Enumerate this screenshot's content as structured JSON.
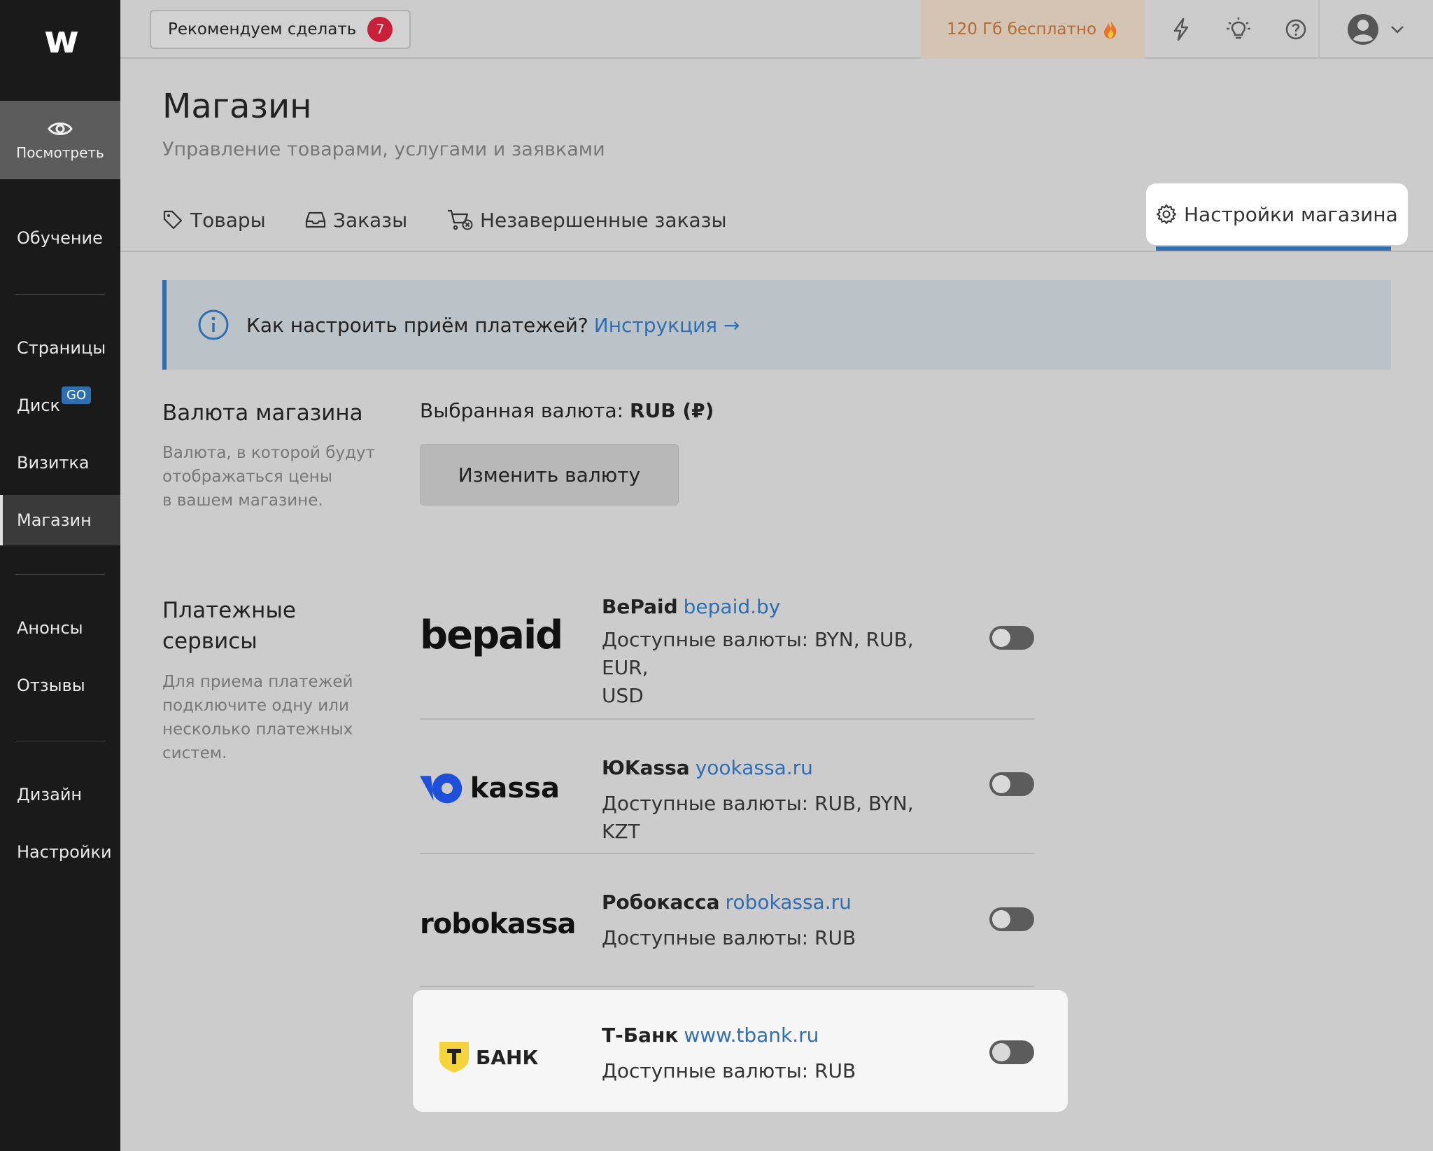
{
  "sidebar": {
    "logo": "w",
    "preview_label": "Посмотреть",
    "items": [
      {
        "label": "Обучение"
      },
      {
        "label": "Страницы"
      },
      {
        "label": "Диск"
      },
      {
        "label": "Визитка"
      },
      {
        "label": "Магазин"
      },
      {
        "label": "Анонсы"
      },
      {
        "label": "Отзывы"
      },
      {
        "label": "Дизайн"
      },
      {
        "label": "Настройки"
      }
    ],
    "go_badge": "GO",
    "active_item": "Магазин"
  },
  "topbar": {
    "recommend_label": "Рекомендуем сделать",
    "recommend_count": "7",
    "free_storage": "120 Гб бесплатно",
    "icons": [
      "lightning-icon",
      "bulb-icon",
      "help-icon",
      "avatar-icon"
    ]
  },
  "page": {
    "title": "Магазин",
    "subtitle": "Управление товарами, услугами и заявками"
  },
  "tabs": [
    {
      "label": "Товары",
      "icon": "tag-icon"
    },
    {
      "label": "Заказы",
      "icon": "tray-icon"
    },
    {
      "label": "Незавершенные заказы",
      "icon": "cart-x-icon"
    },
    {
      "label": "Настройки магазина",
      "icon": "gear-icon",
      "active": true
    }
  ],
  "info_banner": {
    "text": "Как настроить приём платежей?",
    "link": "Инструкция →"
  },
  "currency": {
    "title": "Валюта магазина",
    "desc_lines": [
      "Валюта, в которой будут",
      "отображаться цены",
      "в вашем магазине."
    ],
    "selected_label": "Выбранная валюта:",
    "selected_value": "RUB (₽)",
    "change_button": "Изменить валюту"
  },
  "payments": {
    "title_lines": [
      "Платежные",
      "сервисы"
    ],
    "desc_lines": [
      "Для приема платежей",
      "подключите одну или",
      "несколько платежных",
      "систем."
    ],
    "providers": [
      {
        "name": "BePaid",
        "url": "bepaid.by",
        "logo": "bepaid",
        "currencies_1": "Доступные валюты: BYN, RUB, EUR,",
        "currencies_2": "USD",
        "enabled": false
      },
      {
        "name": "ЮKassa",
        "url": "yookassa.ru",
        "logo": "kassa",
        "currencies_1": "Доступные валюты: RUB, BYN, KZT",
        "enabled": false
      },
      {
        "name": "Робокасса",
        "url": "robokassa.ru",
        "logo": "robokassa",
        "currencies_1": "Доступные валюты: RUB",
        "enabled": false
      },
      {
        "name": "Т-Банк",
        "url": "www.tbank.ru",
        "logo": "БАНК",
        "currencies_1": "Доступные валюты: RUB",
        "enabled": false
      }
    ]
  },
  "colors": {
    "accent": "#2f6fb1",
    "sidebar_bg": "#1a1a1a",
    "badge_red": "#c9203a",
    "free_storage_text": "#b56a2f"
  }
}
